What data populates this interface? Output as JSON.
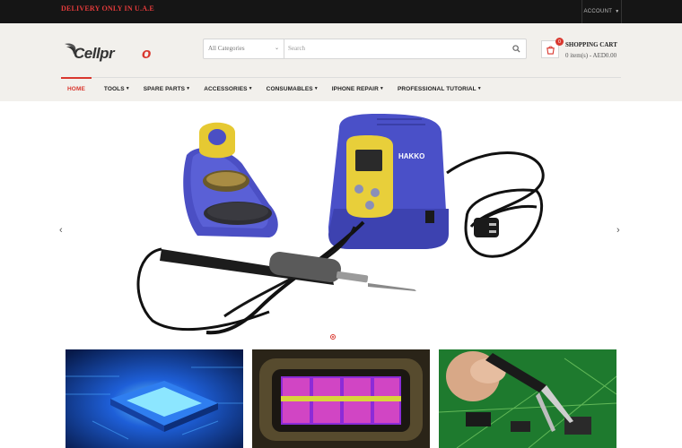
{
  "topbar": {
    "delivery_text": "DELIVERY ONLY IN U.A.E",
    "account_label": "ACCOUNT"
  },
  "header": {
    "logo_text": "Cellpro",
    "search": {
      "category_value": "All Categories",
      "placeholder": "Search"
    },
    "cart": {
      "title": "SHOPPING CART",
      "summary": "0 item(s) - AED0.00",
      "count": "0"
    }
  },
  "nav": {
    "items": [
      {
        "label": "HOME",
        "active": true
      },
      {
        "label": "TOOLS",
        "dropdown": true
      },
      {
        "label": "SPARE PARTS",
        "dropdown": true
      },
      {
        "label": "ACCESSORIES",
        "dropdown": true
      },
      {
        "label": "CONSUMABLES",
        "dropdown": true
      },
      {
        "label": "IPHONE REPAIR",
        "dropdown": true
      },
      {
        "label": "PROFESSIONAL TUTORIAL",
        "dropdown": true
      }
    ]
  },
  "slider": {
    "brand_on_station": "HAKKO",
    "slide_count": 1,
    "active_slide": 1
  },
  "colors": {
    "accent": "#d9372e",
    "topbar_bg": "#151515",
    "header_bg": "#f2f0ec",
    "station_blue": "#4a50c8",
    "station_yellow": "#e8cf3a"
  },
  "icons": [
    "chevron-left-icon",
    "chevron-right-icon",
    "search-icon",
    "cart-icon",
    "caret-down-icon"
  ]
}
